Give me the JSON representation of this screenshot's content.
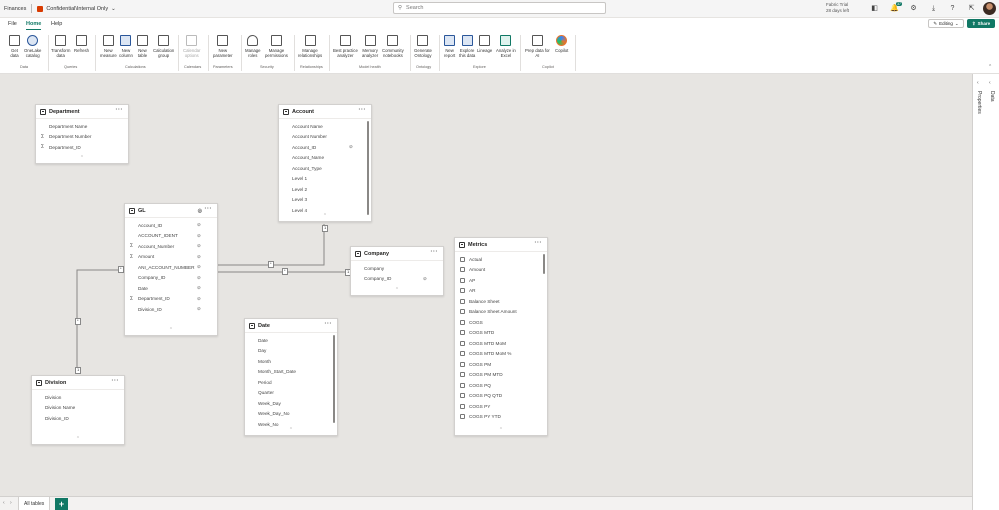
{
  "titlebar": {
    "app_name": "Finances",
    "file_name": "Confidential\\Internal Only",
    "search_placeholder": "Search",
    "trial_user": "Fabric Trial",
    "trial_days": "28 days left",
    "notification_count": "37"
  },
  "tabs": {
    "file": "File",
    "home": "Home",
    "help": "Help"
  },
  "mode": {
    "editing": "Editing",
    "share": "Share"
  },
  "ribbon": {
    "get_data": "Get\ndata",
    "onelake_catalog": "OneLake\ncatalog",
    "transform_data": "Transform\ndata",
    "refresh": "Refresh",
    "new_measure": "New\nmeasure",
    "new_column": "New\ncolumn",
    "new_table": "New\ntable",
    "calculation_group": "Calculation\ngroup",
    "calendar_options": "Calendar\noptions",
    "new_parameter": "New\nparameter",
    "manage_roles": "Manage\nroles",
    "manage_permissions": "Manage\npermissions",
    "manage_relationships": "Manage\nrelationships",
    "best_practice": "Best practice\nanalyzer",
    "memory_analyzer": "Memory\nanalyzer",
    "community_notebooks": "Community\nnotebooks",
    "generate_ontology": "Generate\nOntology",
    "new_report": "New\nreport",
    "explore_this_data": "Explore\nthis data",
    "lineage": "Lineage",
    "analyze_in_excel": "Analyze in\nExcel",
    "prep_data": "Prep data for\nAI",
    "copilot": "Copilot",
    "groups": {
      "data": "Data",
      "queries": "Queries",
      "calculations": "Calculations",
      "calendars": "Calendars",
      "parameters": "Parameters",
      "security": "Security",
      "relationships": "Relationships",
      "model_health": "Model health",
      "ontology": "Ontology",
      "explore": "Explore",
      "copilot": "Copilot"
    }
  },
  "side_panels": {
    "properties": "Properties",
    "data": "Data"
  },
  "tables": {
    "department": {
      "name": "Department",
      "fields": [
        {
          "name": "Department Name",
          "sum": false
        },
        {
          "name": "Department Number",
          "sum": true
        },
        {
          "name": "Department_ID",
          "sum": true
        }
      ]
    },
    "account": {
      "name": "Account",
      "fields": [
        {
          "name": "Account Name",
          "hidden": false
        },
        {
          "name": "Account Number",
          "hidden": false
        },
        {
          "name": "Account_ID",
          "hidden": true
        },
        {
          "name": "Account_Name",
          "hidden": false
        },
        {
          "name": "Account_Type",
          "hidden": false
        },
        {
          "name": "Level 1",
          "hidden": false
        },
        {
          "name": "Level 2",
          "hidden": false
        },
        {
          "name": "Level 3",
          "hidden": false
        },
        {
          "name": "Level 4",
          "hidden": false
        }
      ]
    },
    "gl": {
      "name": "GL",
      "fields": [
        {
          "name": "Account_ID",
          "sum": false
        },
        {
          "name": "ACCOUNT_IDENT",
          "sum": false
        },
        {
          "name": "Account_Number",
          "sum": true
        },
        {
          "name": "Amount",
          "sum": true
        },
        {
          "name": "ANI_ACCOUNT_NUMBER",
          "sum": false
        },
        {
          "name": "Company_ID",
          "sum": false
        },
        {
          "name": "Date",
          "sum": false
        },
        {
          "name": "Department_ID",
          "sum": true
        },
        {
          "name": "Division_ID",
          "sum": false
        }
      ]
    },
    "company": {
      "name": "Company",
      "fields": [
        {
          "name": "Company",
          "hidden": false
        },
        {
          "name": "Company_ID",
          "hidden": true
        }
      ]
    },
    "metrics": {
      "name": "Metrics",
      "fields": [
        "Actual",
        "Amount",
        "AP",
        "AR",
        "Balance Sheet",
        "Balance Sheet Amount",
        "COGS",
        "COGS MTD",
        "COGS MTD MoM",
        "COGS MTD MoM %",
        "COGS PM",
        "COGS PM MTD",
        "COGS PQ",
        "COGS PQ QTD",
        "COGS PY",
        "COGS PY YTD"
      ]
    },
    "date": {
      "name": "Date",
      "fields": [
        "Date",
        "Day",
        "Month",
        "Month_Start_Date",
        "Period",
        "Quarter",
        "Week_Day",
        "Week_Day_No",
        "Week_No"
      ]
    },
    "division": {
      "name": "Division",
      "fields": [
        "Division",
        "Division Name",
        "Division_ID"
      ]
    }
  },
  "relationships": {
    "one": "1",
    "many": "*"
  },
  "bottom": {
    "tab_label": "All tables",
    "add": "+"
  }
}
